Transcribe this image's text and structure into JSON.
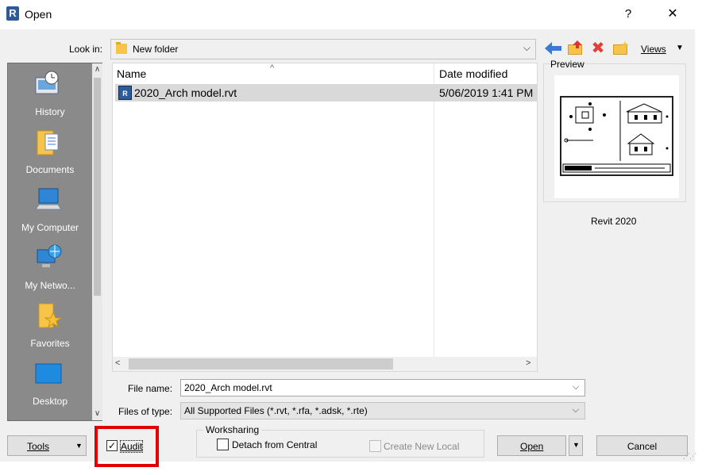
{
  "window": {
    "app_icon_text": "R",
    "title": "Open",
    "help_label": "?",
    "close_label": "✕"
  },
  "lookin": {
    "label": "Look in:",
    "value": "New folder",
    "arrow": "⌵"
  },
  "toolbar": {
    "back_icon": "back-arrow-icon",
    "up_icon": "up-folder-icon",
    "delete_icon": "delete-icon",
    "new_folder_icon": "new-folder-icon",
    "views_label": "Views",
    "views_arrow": "▼"
  },
  "places": {
    "items": [
      {
        "label": "History",
        "icon": "history-icon"
      },
      {
        "label": "Documents",
        "icon": "documents-icon"
      },
      {
        "label": "My Computer",
        "icon": "my-computer-icon"
      },
      {
        "label": "My Netwo...",
        "icon": "my-network-icon"
      },
      {
        "label": "Favorites",
        "icon": "favorites-icon"
      },
      {
        "label": "Desktop",
        "icon": "desktop-icon"
      }
    ],
    "scroll_up": "∧",
    "scroll_down": "∨"
  },
  "file_list": {
    "columns": {
      "name": "Name",
      "date": "Date modified"
    },
    "sort_indicator": "^",
    "rows": [
      {
        "icon_text": "R",
        "name": "2020_Arch model.rvt",
        "date": "5/06/2019 1:41 PM",
        "selected": true
      }
    ],
    "hscroll_left": "<",
    "hscroll_right": ">"
  },
  "preview": {
    "label": "Preview",
    "version": "Revit 2020"
  },
  "file_name": {
    "label": "File name:",
    "value": "2020_Arch model.rvt",
    "arrow": "⌵"
  },
  "file_type": {
    "label": "Files of type:",
    "value": "All Supported Files  (*.rvt, *.rfa, *.adsk, *.rte)",
    "arrow": "⌵"
  },
  "bottom": {
    "tools_label": "Tools",
    "tools_arrow": "▼",
    "audit_label": "Audit",
    "audit_checked": true,
    "audit_check_glyph": "✓",
    "worksharing_title": "Worksharing",
    "detach_label": "Detach from Central",
    "create_local_label": "Create New Local",
    "open_label": "Open",
    "open_dropdown_arrow": "▼",
    "cancel_label": "Cancel"
  },
  "colors": {
    "accent_highlight": "#e00000",
    "places_bg": "#8a8a8a",
    "selection_bg": "#d9d9d9",
    "revit_blue": "#2d5b9a"
  }
}
